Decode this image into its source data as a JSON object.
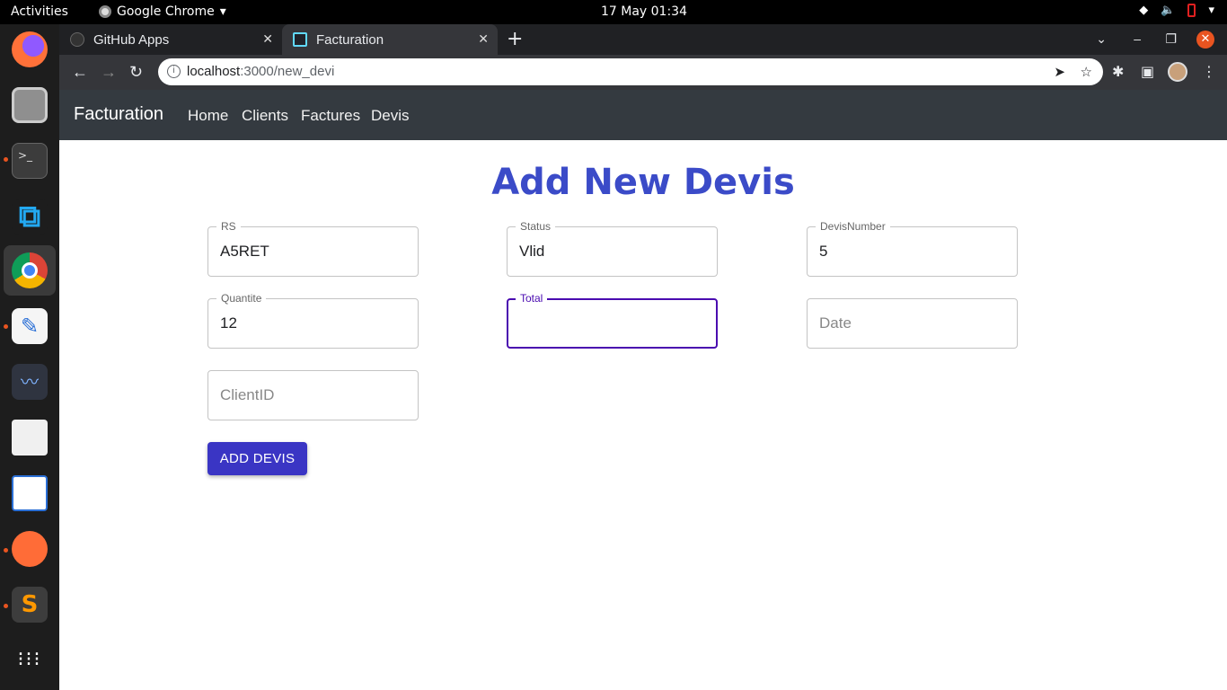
{
  "system": {
    "activities": "Activities",
    "app_name": "Google Chrome",
    "clock": "17 May  01:34"
  },
  "browser": {
    "tabs": [
      {
        "title": "GitHub Apps",
        "favicon": "github-icon"
      },
      {
        "title": "Facturation",
        "favicon": "react-icon"
      }
    ],
    "url_host": "localhost",
    "url_path": ":3000/new_devi"
  },
  "app": {
    "brand": "Facturation",
    "nav": [
      "Home",
      "Clients",
      "Factures",
      "Devis"
    ],
    "page_title": "Add New Devis",
    "fields": {
      "rs": {
        "label": "RS",
        "value": "A5RET"
      },
      "status": {
        "label": "Status",
        "value": "Vlid"
      },
      "devis_number": {
        "label": "DevisNumber",
        "value": "5"
      },
      "quantite": {
        "label": "Quantite",
        "value": "12"
      },
      "total": {
        "label": "Total",
        "value": ""
      },
      "date": {
        "placeholder": "Date"
      },
      "client_id": {
        "placeholder": "ClientID"
      }
    },
    "submit_label": "ADD DEVIS",
    "accent_color": "#3b4bc8",
    "focus_color": "#4a0bb0"
  }
}
